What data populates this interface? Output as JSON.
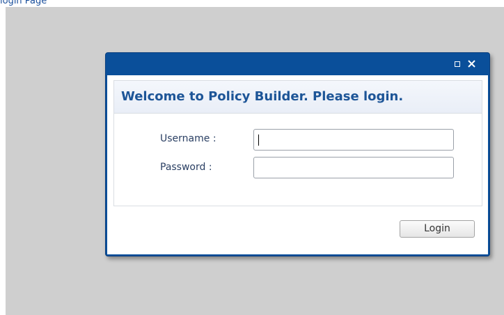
{
  "page": {
    "heading": "login Page"
  },
  "dialog": {
    "title": "Welcome to Policy Builder. Please login.",
    "username_label": "Username :",
    "username_value": "",
    "password_label": "Password :",
    "password_value": "",
    "login_button": "Login",
    "titlebar_buttons": [
      "maximize-icon",
      "close-icon"
    ],
    "colors": {
      "titlebar": "#0a4f9a",
      "title_text": "#1d5597",
      "backdrop": "#cfcfcf"
    }
  }
}
